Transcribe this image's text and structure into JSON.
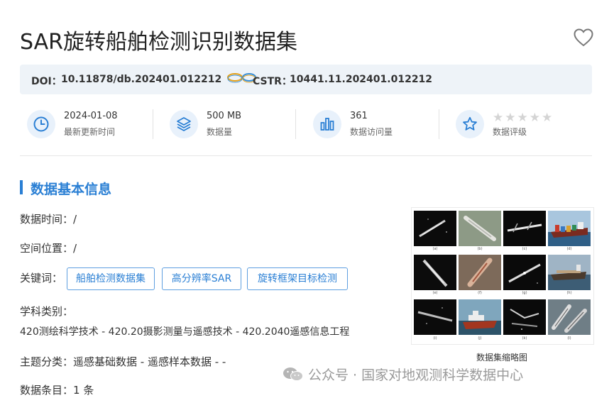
{
  "header": {
    "title": "SAR旋转船舶检测识别数据集"
  },
  "identifiers": {
    "doi_label": "DOI：",
    "doi_value": "10.11878/db.202401.012212",
    "cstr_label": "CSTR：",
    "cstr_value": "10441.11.202401.012212"
  },
  "stats": [
    {
      "value": "2024-01-08",
      "label": "最新更新时间",
      "icon": "clock-icon"
    },
    {
      "value": "500 MB",
      "label": "数据量",
      "icon": "layers-icon"
    },
    {
      "value": "361",
      "label": "数据访问量",
      "icon": "bar-chart-icon"
    },
    {
      "value": "",
      "label": "数据评级",
      "icon": "star-icon",
      "rating": 0,
      "max_rating": 5
    }
  ],
  "section": {
    "title": "数据基本信息"
  },
  "info": {
    "time_label": "数据时间：",
    "time_value": "/",
    "space_label": "空间位置：",
    "space_value": "/",
    "keywords_label": "关键词：",
    "keywords": [
      "船舶检测数据集",
      "高分辨率SAR",
      "旋转框架目标检测"
    ],
    "subject_label": "学科类别：",
    "subject_value": "420测绘科学技术 - 420.20摄影测量与遥感技术 - 420.2040遥感信息工程",
    "theme_label": "主题分类：",
    "theme_value": "遥感基础数据 - 遥感样本数据 - -",
    "count_label": "数据条目：",
    "count_value": "1 条"
  },
  "thumbnail": {
    "caption": "数据集缩略图",
    "panel_labels": [
      "(a)",
      "(b)",
      "(c)",
      "(d)",
      "(e)",
      "(f)",
      "(g)",
      "(h)",
      "(i)",
      "(j)",
      "(k)",
      "(l)"
    ]
  },
  "watermark": {
    "text": "公众号 · 国家对地观测科学数据中心"
  },
  "colors": {
    "accent": "#2a7fd4",
    "doi_bar_bg": "#eef3f8",
    "icon_bg": "#e8f1fb"
  }
}
